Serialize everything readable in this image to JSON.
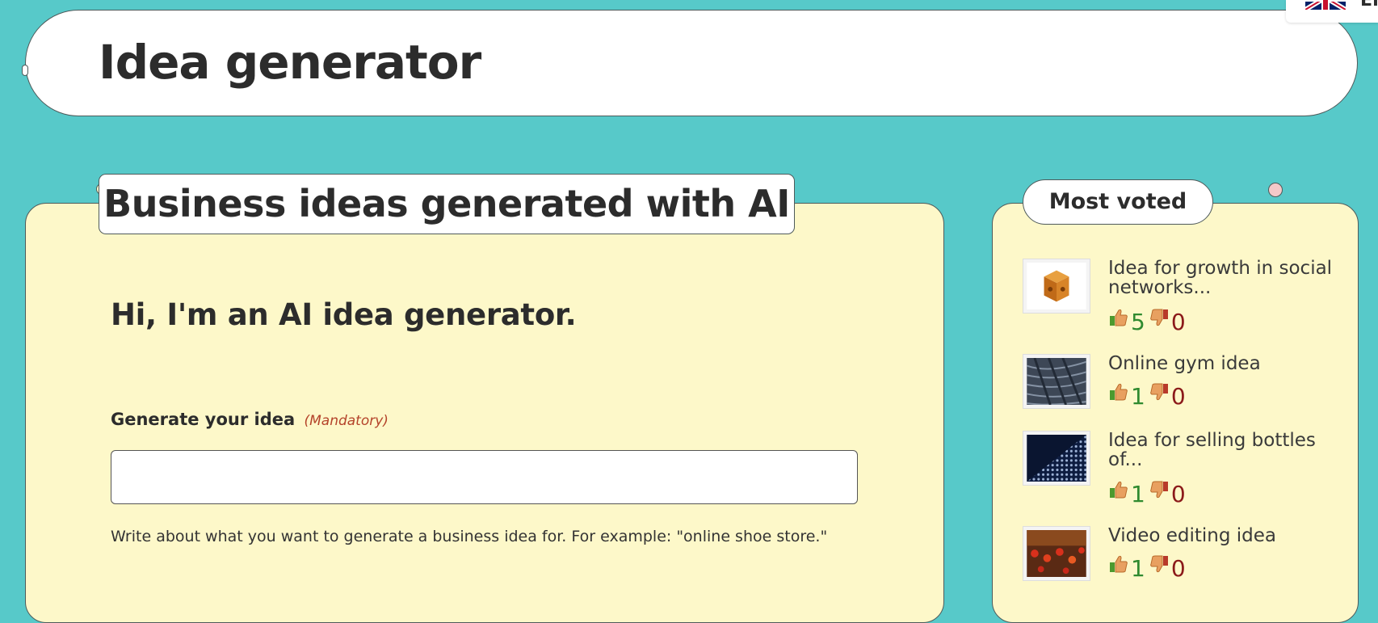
{
  "header": {
    "title": "Idea generator"
  },
  "language": {
    "code": "EN",
    "flag": "uk-flag-icon"
  },
  "main": {
    "tab_title": "Business ideas generated with AI",
    "greeting": "Hi, I'm an AI idea generator.",
    "field_label": "Generate your idea",
    "mandatory": "(Mandatory)",
    "input_value": "",
    "input_placeholder": "",
    "help_text": "Write about what you want to generate a business idea for. For example: \"online shoe store.\""
  },
  "sidebar": {
    "title": "Most voted",
    "items": [
      {
        "title": "Idea for growth in social networks...",
        "up": "5",
        "down": "0",
        "thumb": "orange-cube-image"
      },
      {
        "title": "Online gym idea",
        "up": "1",
        "down": "0",
        "thumb": "dark-feathers-image"
      },
      {
        "title": "Idea for selling bottles of...",
        "up": "1",
        "down": "0",
        "thumb": "blue-dots-image"
      },
      {
        "title": "Video editing idea",
        "up": "1",
        "down": "0",
        "thumb": "red-lanterns-image"
      }
    ]
  },
  "colors": {
    "background": "#57c9c9",
    "card": "#fdf8c9",
    "upvote": "#2f8a2f",
    "downvote": "#8b1a1a",
    "mandatory": "#b4432a"
  }
}
